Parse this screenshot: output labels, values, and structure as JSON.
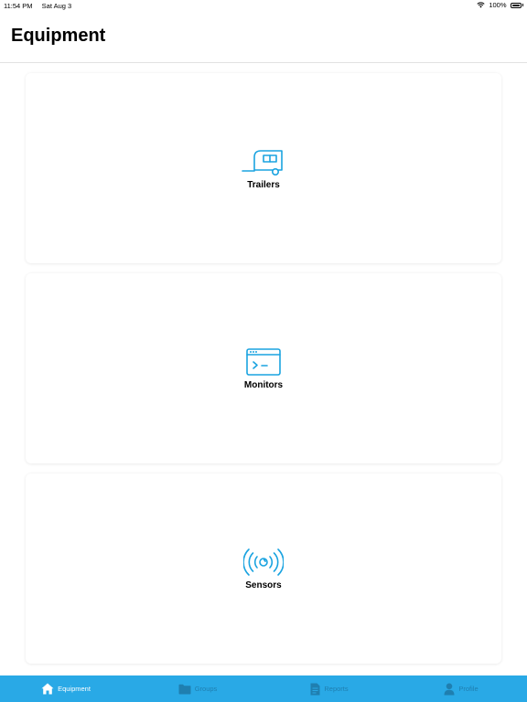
{
  "status_bar": {
    "time": "11:54 PM",
    "date": "Sat Aug 3",
    "battery": "100%"
  },
  "header": {
    "title": "Equipment"
  },
  "cards": [
    {
      "label": "Trailers",
      "icon": "trailer-icon"
    },
    {
      "label": "Monitors",
      "icon": "monitor-terminal-icon"
    },
    {
      "label": "Sensors",
      "icon": "sensor-signal-icon"
    }
  ],
  "tabs": [
    {
      "label": "Equipment",
      "icon": "home-icon",
      "active": true
    },
    {
      "label": "Groups",
      "icon": "folder-icon",
      "active": false
    },
    {
      "label": "Reports",
      "icon": "document-icon",
      "active": false
    },
    {
      "label": "Profile",
      "icon": "person-icon",
      "active": false
    }
  ],
  "colors": {
    "accent": "#29a9e6",
    "icon_blue": "#1aa3e0",
    "tab_inactive": "#1f7fb0",
    "tab_active": "#ffffff"
  }
}
